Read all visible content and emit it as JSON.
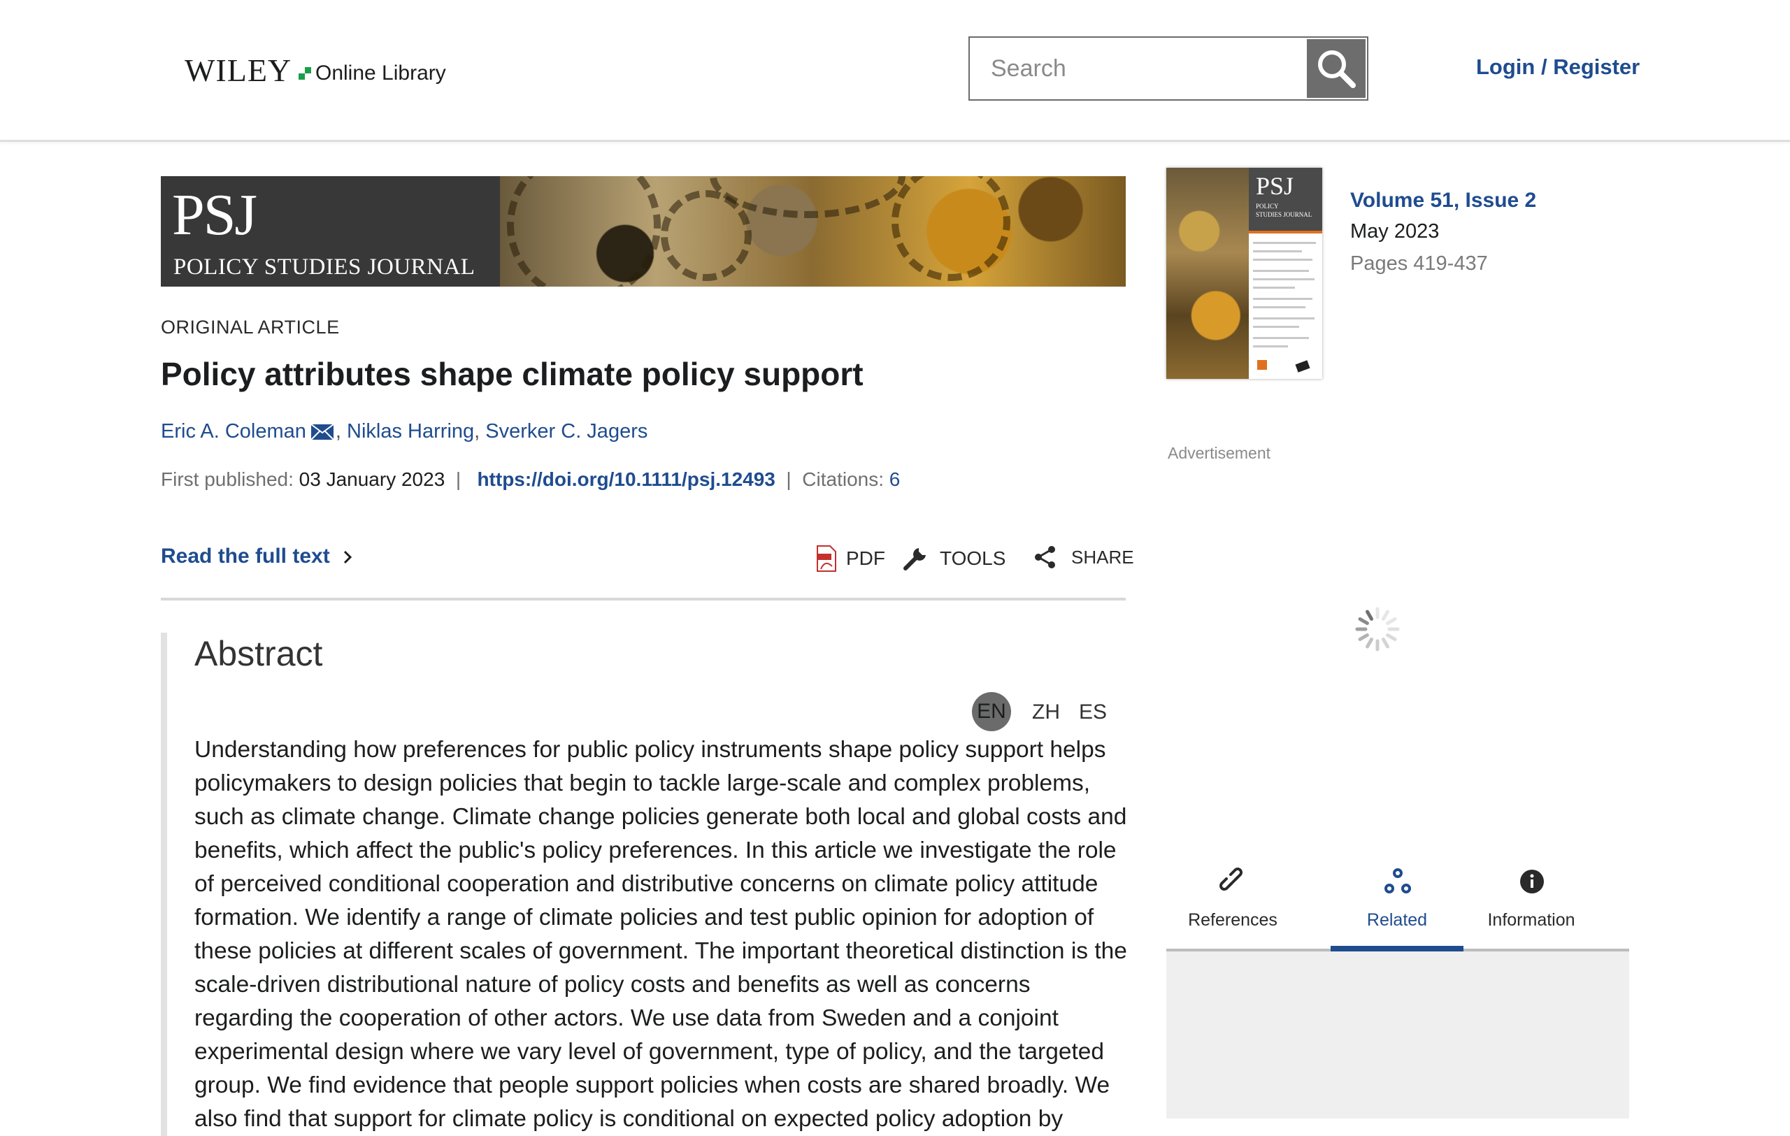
{
  "header": {
    "logo_wordmark": "WILEY",
    "logo_suffix": "Online Library",
    "search_placeholder": "Search",
    "login_label": "Login / Register"
  },
  "banner": {
    "abbr": "PSJ",
    "journal_name": "POLICY STUDIES JOURNAL"
  },
  "article": {
    "type": "ORIGINAL ARTICLE",
    "title": "Policy attributes shape climate policy support",
    "authors": [
      "Eric A. Coleman",
      "Niklas Harring",
      "Sverker C. Jagers"
    ],
    "first_published_label": "First published:",
    "first_published_date": "03 January 2023",
    "doi": "https://doi.org/10.1111/psj.12493",
    "citations_label": "Citations:",
    "citations_count": "6"
  },
  "actions": {
    "read_full_text": "Read the full text",
    "pdf": "PDF",
    "tools": "TOOLS",
    "share": "SHARE"
  },
  "abstract": {
    "heading": "Abstract",
    "languages": [
      "EN",
      "ZH",
      "ES"
    ],
    "active_language": "EN",
    "text": "Understanding how preferences for public policy instruments shape policy support helps policymakers to design policies that begin to tackle large-scale and complex problems, such as climate change. Climate change policies generate both local and global costs and benefits, which affect the public's policy preferences. In this article we investigate the role of perceived conditional cooperation and distributive concerns on climate policy attitude formation. We identify a range of climate policies and test public opinion for adoption of these policies at different scales of government. The important theoretical distinction is the scale-driven distributional nature of policy costs and benefits as well as concerns regarding the cooperation of other actors. We use data from Sweden and a conjoint experimental design where we vary level of government, type of policy, and the targeted group. We find evidence that people support policies when costs are shared broadly. We also find that support for climate policy is conditional on expected policy adoption by"
  },
  "issue": {
    "volume": "Volume 51, Issue 2",
    "date": "May 2023",
    "pages": "Pages 419-437",
    "cover_abbr": "PSJ",
    "cover_name_1": "POLICY",
    "cover_name_2": "STUDIES JOURNAL"
  },
  "sidebar": {
    "advertisement_label": "Advertisement",
    "tabs": [
      {
        "label": "References",
        "icon": "link-icon"
      },
      {
        "label": "Related",
        "icon": "related-icon"
      },
      {
        "label": "Information",
        "icon": "info-icon"
      }
    ],
    "active_tab": "Related"
  },
  "colors": {
    "link_blue": "#1f4c8f",
    "logo_green": "#1a9e4a",
    "search_button": "#6d6d6d"
  }
}
